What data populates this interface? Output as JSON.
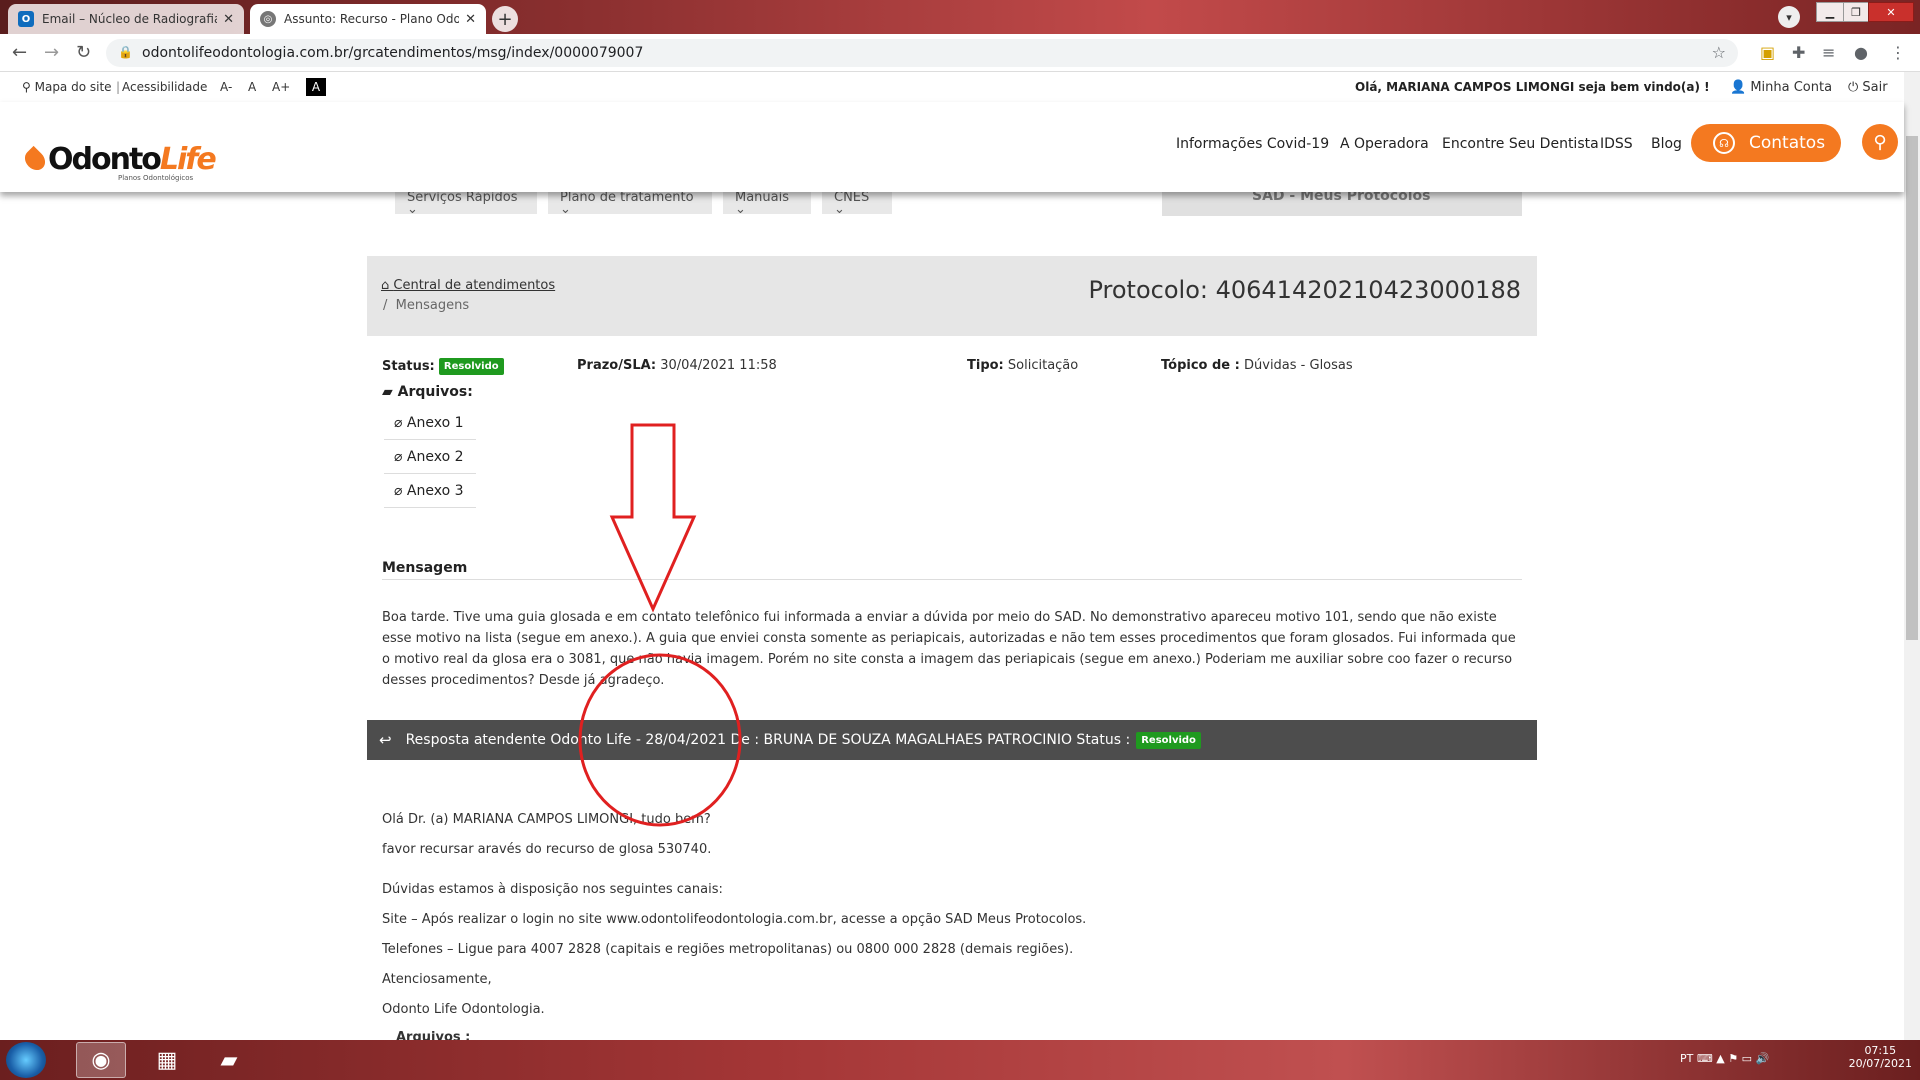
{
  "browser": {
    "tabs": [
      {
        "title": "Email – Núcleo de Radiografias V",
        "icon": "outlook-icon",
        "active": false
      },
      {
        "title": "Assunto: Recurso - Plano Odonto",
        "icon": "page-icon",
        "active": true
      }
    ],
    "url": "odontolifeodontologia.com.br/grcatendimentos/msg/index/0000079007"
  },
  "site": {
    "topbar": {
      "sitemap": "Mapa do site",
      "accessibility": "Acessibilidade",
      "font_smaller": "A-",
      "font_normal": "A",
      "font_larger": "A+",
      "contrast": "A",
      "welcome": "Olá, MARIANA CAMPOS LIMONGI seja bem vindo(a) !",
      "account": "Minha Conta",
      "logout": "Sair"
    },
    "logo": {
      "odonto": "Odonto",
      "life": "Life",
      "sub": "Planos Odontológicos"
    },
    "nav": [
      "Informações Covid-19",
      "A Operadora",
      "Encontre Seu Dentista",
      "IDSS",
      "Blog"
    ],
    "contatos": "Contatos",
    "subnav": [
      "Serviços Rápidos",
      "Plano de tratamento",
      "Manuais",
      "CNES"
    ],
    "sad": "SAD - Meus Protocolos"
  },
  "ticket": {
    "breadcrumb_home": "Central de atendimentos",
    "breadcrumb_current": "Mensagens",
    "protocol": "Protocolo: 40641420210423000188",
    "status_label": "Status:",
    "status_value": "Resolvido",
    "prazo_label": "Prazo/SLA:",
    "prazo_value": "30/04/2021 11:58",
    "tipo_label": "Tipo:",
    "tipo_value": "Solicitação",
    "topico_label": "Tópico de :",
    "topico_value": "Dúvidas - Glosas",
    "files_label": "Arquivos:",
    "files": [
      "Anexo 1",
      "Anexo 2",
      "Anexo 3"
    ],
    "message_title": "Mensagem",
    "message_body": "Boa tarde. Tive uma guia glosada e em contato telefônico fui informada a enviar a dúvida por meio do SAD. No demonstrativo apareceu motivo 101, sendo que não existe esse motivo na lista (segue em anexo.). A guia que enviei consta somente as periapicais, autorizadas e não tem esses procedimentos que foram glosados. Fui informada que o motivo real da glosa era o 3081, que não havia imagem. Porém no site consta a imagem das periapicais (segue em anexo.) Poderiam me auxiliar sobre coo fazer o recurso desses procedimentos? Desde já agradeço.",
    "response_header": "Resposta atendente Odonto Life - 28/04/2021 De : BRUNA DE SOUZA MAGALHAES PATROCINIO Status :",
    "response_status": "Resolvido",
    "response_lines": [
      "Olá Dr. (a) MARIANA CAMPOS LIMONGI, tudo bem?",
      "favor recursar aravés do recurso de glosa 530740.",
      "Dúvidas estamos à disposição nos seguintes canais:",
      "Site – Após realizar o login no site www.odontolifeodontologia.com.br, acesse a opção SAD Meus Protocolos.",
      "Telefones – Ligue para 4007 2828 (capitais e regiões metropolitanas) ou 0800 000 2828 (demais regiões).",
      "Atenciosamente,",
      "Odonto Life Odontologia.",
      "Arquivos :"
    ]
  },
  "taskbar": {
    "language": "PT",
    "time": "07:15",
    "date": "20/07/2021"
  },
  "colors": {
    "brand_orange": "#f47920",
    "status_green": "#1f9a1f",
    "response_bar": "#4d4d4d",
    "annotation_red": "#e02020"
  }
}
